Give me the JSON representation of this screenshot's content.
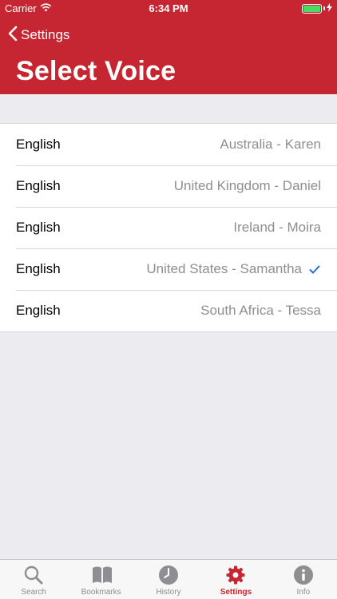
{
  "colors": {
    "accent": "#C62631",
    "check": "#1E6FD9",
    "secondary_text": "#8E8E93",
    "background": "#EBEBF0"
  },
  "status_bar": {
    "carrier": "Carrier",
    "time": "6:34 PM"
  },
  "nav": {
    "back_label": "Settings",
    "title": "Select Voice"
  },
  "voices": [
    {
      "language": "English",
      "voice": "Australia - Karen",
      "selected": false
    },
    {
      "language": "English",
      "voice": "United Kingdom - Daniel",
      "selected": false
    },
    {
      "language": "English",
      "voice": "Ireland - Moira",
      "selected": false
    },
    {
      "language": "English",
      "voice": "United States - Samantha",
      "selected": true
    },
    {
      "language": "English",
      "voice": "South Africa - Tessa",
      "selected": false
    }
  ],
  "tabs": [
    {
      "label": "Search",
      "icon": "search-icon"
    },
    {
      "label": "Bookmarks",
      "icon": "book-icon"
    },
    {
      "label": "History",
      "icon": "clock-icon"
    },
    {
      "label": "Settings",
      "icon": "gear-icon",
      "active": true
    },
    {
      "label": "Info",
      "icon": "info-icon"
    }
  ]
}
